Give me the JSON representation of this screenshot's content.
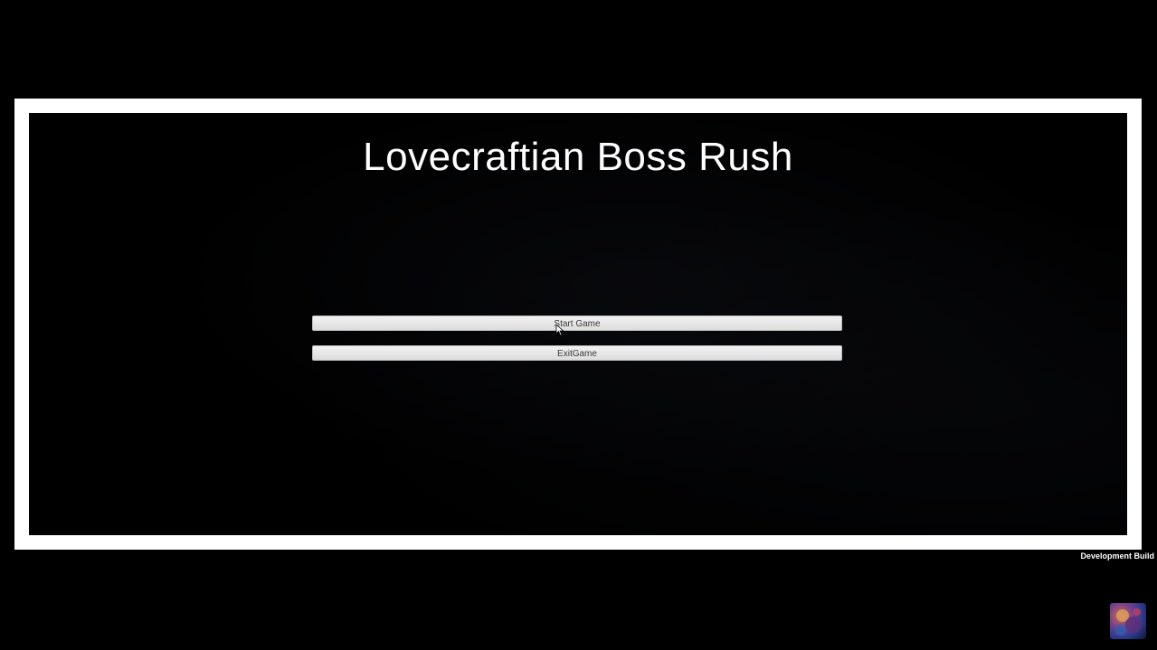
{
  "game": {
    "title": "Lovecraftian Boss Rush",
    "menu": {
      "start_label": "Start Game",
      "exit_label": "ExitGame"
    },
    "build_label": "Development Build"
  },
  "colors": {
    "background": "#000000",
    "frame": "#ffffff",
    "button": "#e6e6e6",
    "button_text": "#3a3a3a"
  },
  "icons": {
    "cursor": "mouse-cursor-icon",
    "avatar": "streamer-avatar-icon"
  }
}
